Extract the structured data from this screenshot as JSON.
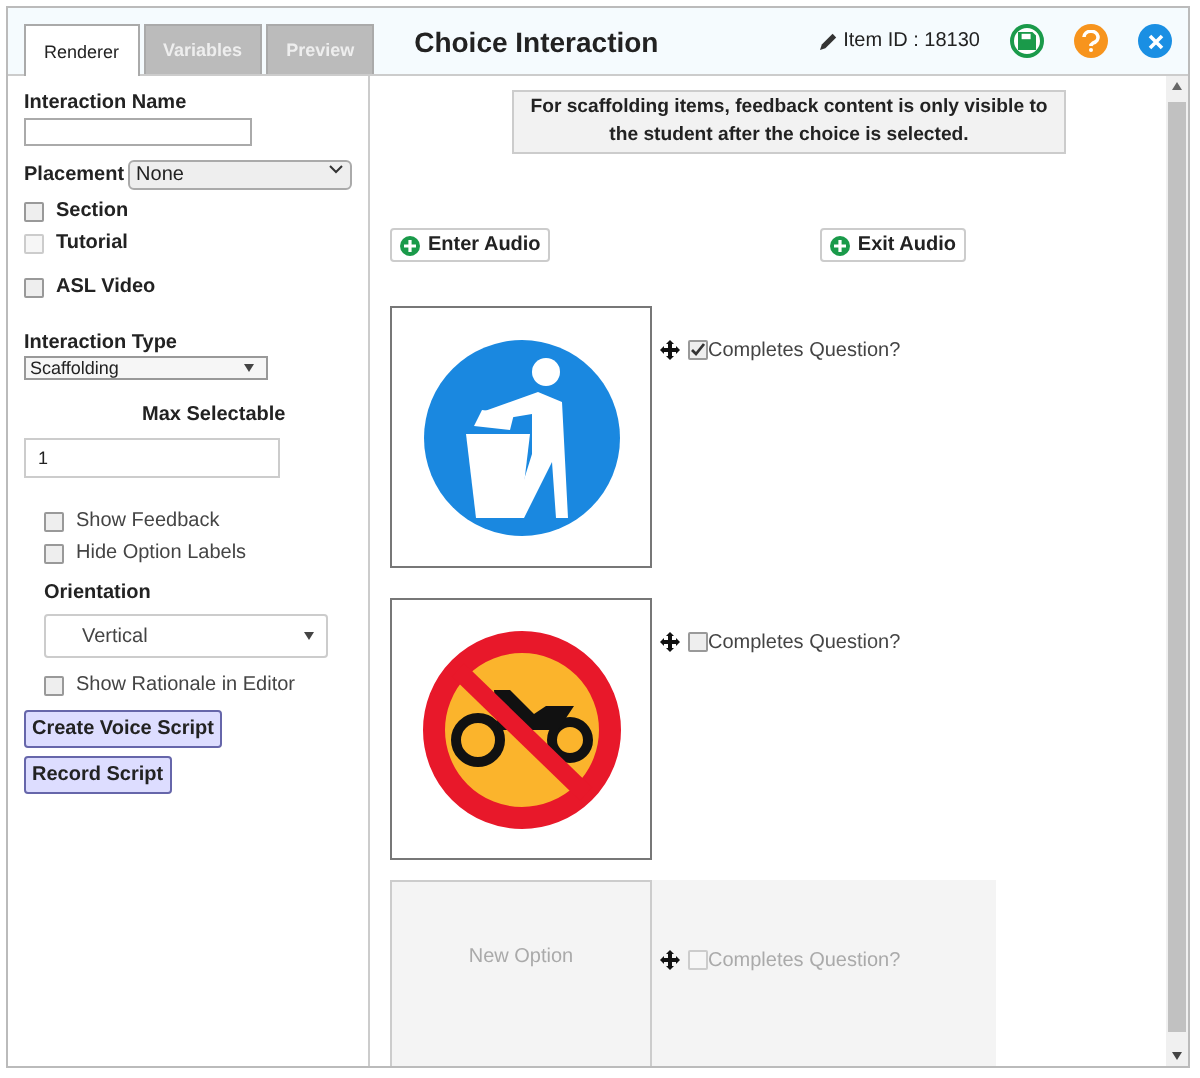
{
  "tabs": [
    {
      "label": "Renderer",
      "selected": true
    },
    {
      "label": "Variables",
      "selected": false
    },
    {
      "label": "Preview",
      "selected": false
    }
  ],
  "title": "Choice Interaction",
  "item_id": "Item ID : 18130",
  "sidebar": {
    "name_label": "Interaction Name",
    "placement_label": "Placement",
    "placement_value": "None",
    "flags": [
      {
        "label": "Section",
        "checked": false,
        "disabled": false
      },
      {
        "label": "Tutorial",
        "checked": false,
        "disabled": true
      },
      {
        "label": "ASL Video",
        "checked": false,
        "disabled": false
      }
    ],
    "type_label": "Interaction Type",
    "type_value": "Scaffolding",
    "max_label": "Max Selectable",
    "max_value": "1",
    "options": [
      {
        "label": "Show Feedback",
        "checked": false
      },
      {
        "label": "Hide Option Labels",
        "checked": false
      }
    ],
    "orientation_label": "Orientation",
    "orientation_value": "Vertical",
    "rationale": {
      "label": "Show Rationale in Editor",
      "checked": false
    },
    "buttons": [
      "Create Voice Script",
      "Record Script"
    ]
  },
  "notice": "For scaffolding items, feedback content is only visible to the student after the choice is selected.",
  "audio_buttons": [
    "Enter Audio",
    "Exit Audio"
  ],
  "choices": [
    {
      "kind": "litter-sign",
      "completes_label": "Completes Question?",
      "checked": true,
      "disabled": false
    },
    {
      "kind": "no-moped-sign",
      "completes_label": "Completes Question?",
      "checked": false,
      "disabled": false
    },
    {
      "kind": "new",
      "label": "New Option",
      "completes_label": "Completes Question?",
      "checked": false,
      "disabled": true
    }
  ]
}
